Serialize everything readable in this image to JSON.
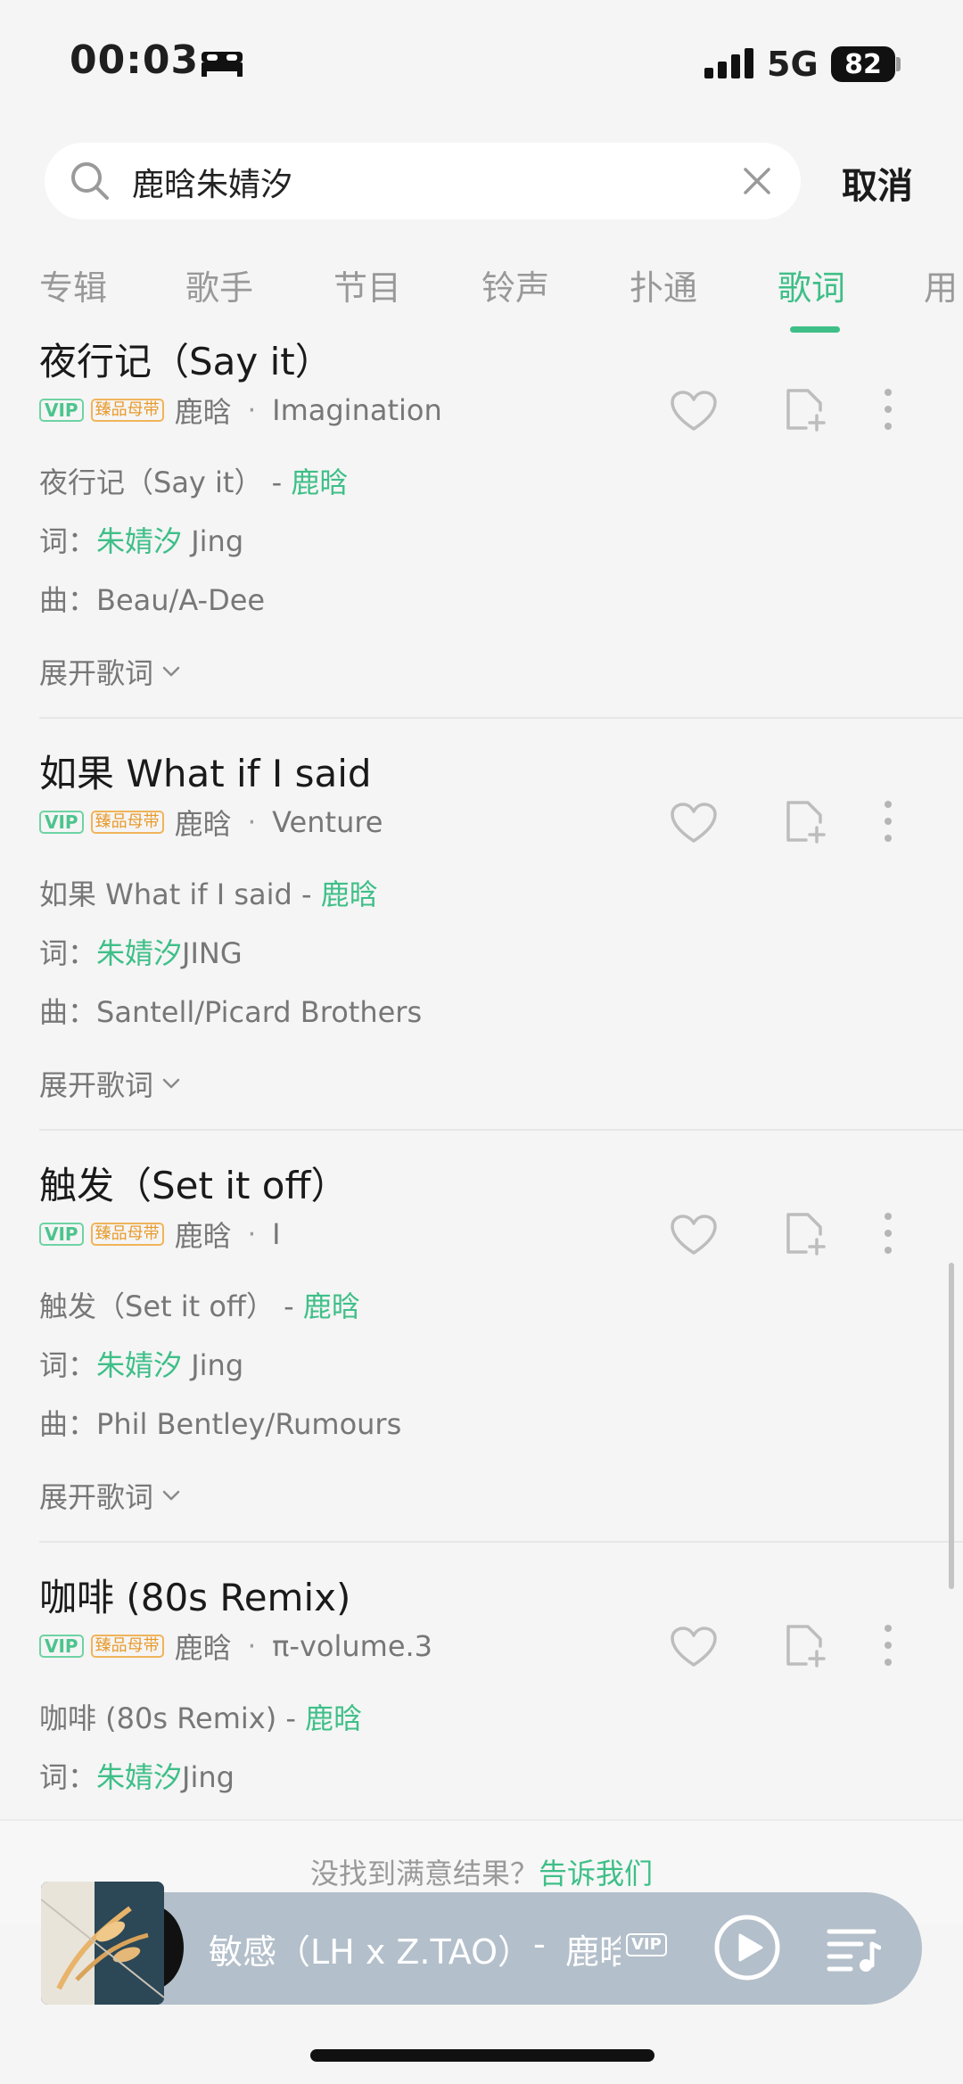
{
  "status": {
    "time": "00:03",
    "network": "5G",
    "battery": "82"
  },
  "search": {
    "query": "鹿晗朱婧汐",
    "cancel_label": "取消"
  },
  "tabs": [
    {
      "label": "专辑"
    },
    {
      "label": "歌手"
    },
    {
      "label": "节目"
    },
    {
      "label": "铃声"
    },
    {
      "label": "扑通"
    },
    {
      "label": "歌词"
    },
    {
      "label": "用"
    }
  ],
  "active_tab": "歌词",
  "badges": {
    "vip": "VIP",
    "hq": "臻品母带"
  },
  "results": [
    {
      "title": "夜行记（Say it）",
      "artist": "鹿晗",
      "album": "Imagination",
      "song_line": "夜行记（Say it）",
      "song_artist": "鹿晗",
      "lyricist_label": "词：",
      "lyricist": "朱婧汐",
      "lyricist_suffix": " Jing",
      "composer_label": "曲：",
      "composer": "Beau/A-Dee",
      "expand_label": "展开歌词"
    },
    {
      "title": "如果 What if I said",
      "artist": "鹿晗",
      "album": "Venture",
      "song_line": "如果 What if I said",
      "song_artist": "鹿晗",
      "lyricist_label": "词：",
      "lyricist": "朱婧汐",
      "lyricist_suffix": "JING",
      "composer_label": "曲：",
      "composer": "Santell/Picard Brothers",
      "expand_label": "展开歌词"
    },
    {
      "title": "触发（Set it off）",
      "artist": "鹿晗",
      "album": "I",
      "song_line": "触发（Set it off）",
      "song_artist": "鹿晗",
      "lyricist_label": "词：",
      "lyricist": "朱婧汐",
      "lyricist_suffix": " Jing",
      "composer_label": "曲：",
      "composer": "Phil Bentley/Rumours",
      "expand_label": "展开歌词"
    },
    {
      "title": "咖啡 (80s Remix)",
      "artist": "鹿晗",
      "album": "π-volume.3",
      "song_line": "咖啡 (80s Remix)",
      "song_artist": "鹿晗",
      "lyricist_label": "词：",
      "lyricist": "朱婧汐",
      "lyricist_suffix": "Jing"
    }
  ],
  "feedback": {
    "text": "没找到满意结果？",
    "link": "告诉我们"
  },
  "player": {
    "song": "敏感（LH x Z.TAO）",
    "separator": "-",
    "artist": "鹿晗",
    "vip": "VIP"
  },
  "colors": {
    "accent": "#3fbf88",
    "vip_border": "#6ed3a4",
    "hq_border": "#f0b45a",
    "player_bg": "#b3bfca"
  }
}
